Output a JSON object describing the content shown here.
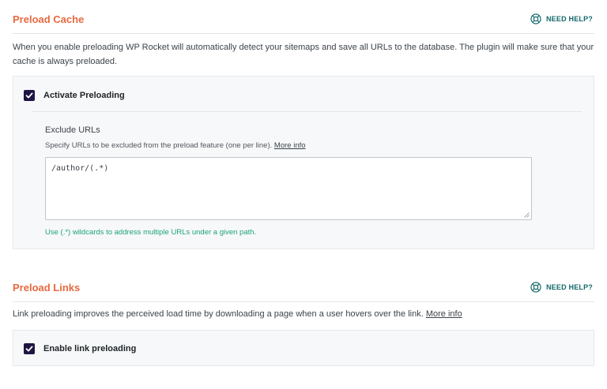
{
  "preload_cache": {
    "title": "Preload Cache",
    "help_label": "NEED HELP?",
    "description": "When you enable preloading WP Rocket will automatically detect your sitemaps and save all URLs to the database. The plugin will make sure that your cache is always preloaded.",
    "activate_label": "Activate Preloading",
    "activate_checked": true,
    "exclude": {
      "label": "Exclude URLs",
      "hint": "Specify URLs to be excluded from the preload feature (one per line).",
      "hint_link": "More info",
      "value": "/author/(.*)",
      "note": "Use (.*) wildcards to address multiple URLs under a given path."
    }
  },
  "preload_links": {
    "title": "Preload Links",
    "help_label": "NEED HELP?",
    "description": "Link preloading improves the perceived load time by downloading a page when a user hovers over the link.",
    "description_link": "More info",
    "enable_label": "Enable link preloading",
    "enable_checked": true
  },
  "colors": {
    "section_title": "#e8693f",
    "help_text": "#14696b",
    "checkbox": "#1f1543",
    "note": "#1aa37a"
  },
  "icons": {
    "help": "lifebuoy-icon",
    "check": "checkmark-icon"
  }
}
